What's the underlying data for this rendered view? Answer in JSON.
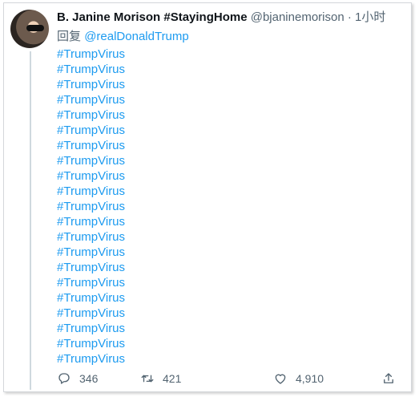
{
  "tweet": {
    "author_name": "B. Janine Morison #StayingHome",
    "handle": "@bjaninemorison",
    "separator": "·",
    "time": "1小时",
    "reply_prefix": "回复",
    "reply_to": "@realDonaldTrump",
    "hashtags": [
      "#TrumpVirus",
      "#TrumpVirus",
      "#TrumpVirus",
      "#TrumpVirus",
      "#TrumpVirus",
      "#TrumpVirus",
      "#TrumpVirus",
      "#TrumpVirus",
      "#TrumpVirus",
      "#TrumpVirus",
      "#TrumpVirus",
      "#TrumpVirus",
      "#TrumpVirus",
      "#TrumpVirus",
      "#TrumpVirus",
      "#TrumpVirus",
      "#TrumpVirus",
      "#TrumpVirus",
      "#TrumpVirus",
      "#TrumpVirus",
      "#TrumpVirus"
    ],
    "actions": {
      "reply_count": "346",
      "retweet_count": "421",
      "like_count": "4,910"
    },
    "icons": {
      "reply": "reply-icon",
      "retweet": "retweet-icon",
      "like": "heart-icon",
      "share": "share-icon"
    },
    "colors": {
      "link": "#1d9bf0",
      "secondary_text": "#536471",
      "primary_text": "#0f1419"
    }
  }
}
